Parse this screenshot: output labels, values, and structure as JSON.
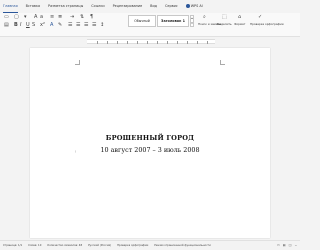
{
  "menu": {
    "tabs": [
      "Главная",
      "Вставка",
      "Разметка страницы",
      "Ссылки",
      "Рецензирование",
      "Вид",
      "Сервис"
    ],
    "active_tab": "Главная",
    "ai_label": "WPS AI"
  },
  "ribbon": {
    "style_normal": "Обычный",
    "style_heading1": "Заголовок 1",
    "find_replace": "Поиск и замена",
    "select": "Выделить",
    "paste_format": "Формат",
    "spell_check": "Проверка орфографии"
  },
  "document": {
    "title": "БРОШЕННЫЙ ГОРОД",
    "subtitle": "10 август 2007 – 3 июль 2008"
  },
  "status": {
    "page": "Страница: 1/1",
    "words": "Слова: 10",
    "chars": "Количество символов: 48",
    "lang": "Русский (Россия)",
    "spell": "Проверка орфографии",
    "mode": "Режим ограниченной функциональности"
  },
  "colors": {
    "accent": "#2b579a",
    "page": "#ffffff",
    "chrome": "#f3f3f3"
  }
}
